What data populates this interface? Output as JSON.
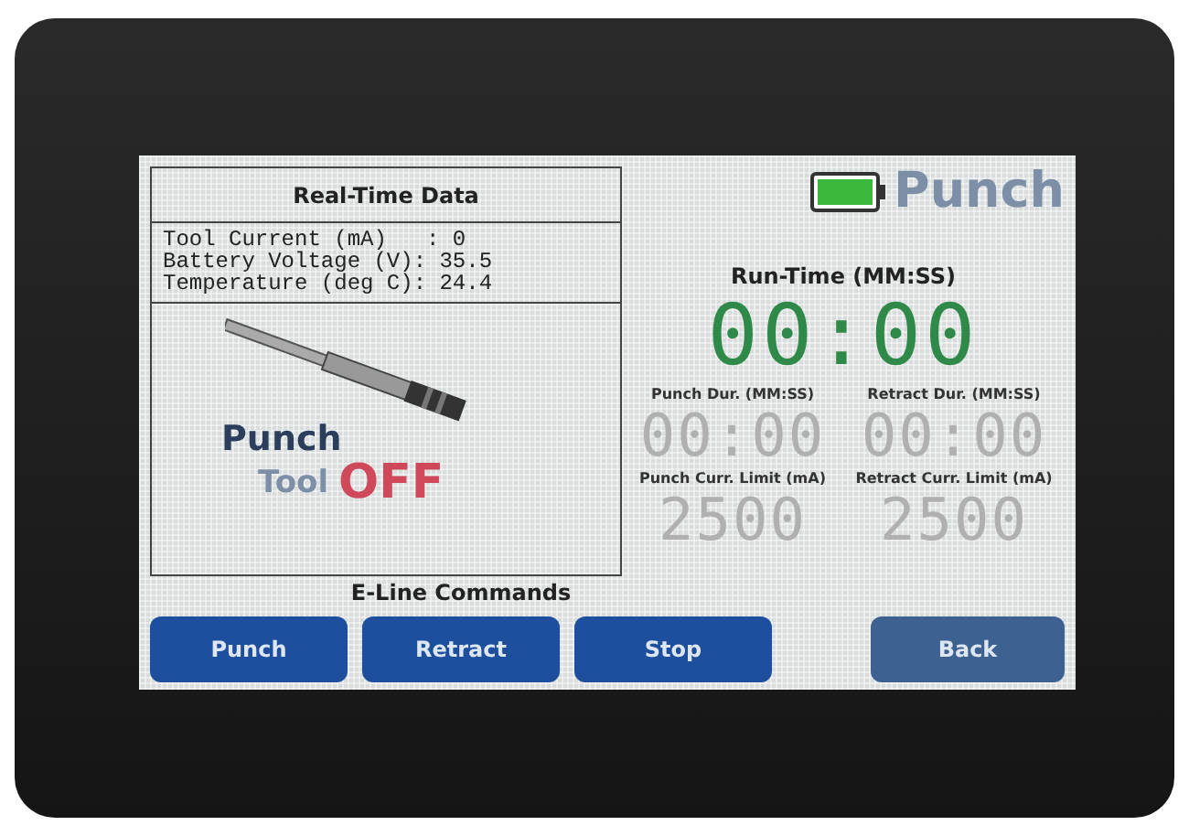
{
  "real_time_data": {
    "title": "Real-Time Data",
    "lines": [
      "Tool Current (mA)   : 0",
      "Battery Voltage (V): 35.5",
      "Temperature (deg C): 24.4"
    ]
  },
  "tool_status": {
    "name": "Punch",
    "label": "Tool",
    "state": "OFF"
  },
  "commands_title": "E-Line Commands",
  "command_buttons": [
    "Punch",
    "Retract",
    "Stop"
  ],
  "mode": "Punch",
  "run_time": {
    "label": "Run-Time (MM:SS)",
    "value": "00:00"
  },
  "settings": [
    {
      "label": "Punch Dur. (MM:SS)",
      "value": "00:00"
    },
    {
      "label": "Retract Dur. (MM:SS)",
      "value": "00:00"
    },
    {
      "label": "Punch Curr. Limit (mA)",
      "value": "2500"
    },
    {
      "label": "Retract Curr. Limit (mA)",
      "value": "2500"
    }
  ],
  "back_button": "Back"
}
